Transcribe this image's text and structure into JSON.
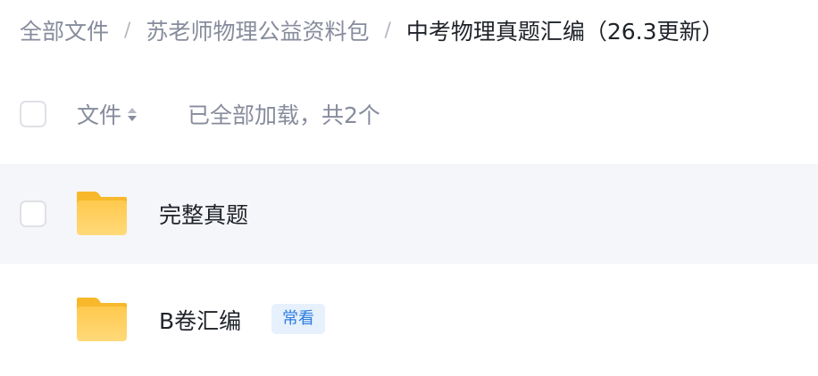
{
  "breadcrumb": {
    "items": [
      "全部文件",
      "苏老师物理公益资料包",
      "中考物理真题汇编（26.3更新）"
    ],
    "separator": "/"
  },
  "list_header": {
    "file_column_label": "文件",
    "sort_icon": "sort-updown-icon",
    "load_status": "已全部加载，共2个"
  },
  "files": [
    {
      "name": "完整真题",
      "type": "folder",
      "icon": "folder-icon",
      "tag": ""
    },
    {
      "name": "B卷汇编",
      "type": "folder",
      "icon": "folder-icon",
      "tag": "常看"
    }
  ],
  "colors": {
    "folder": "#ffc84a",
    "row_hover": "#f5f6f9",
    "tag_background": "#e6f1fd",
    "tag_text": "#2d7de0",
    "muted_text": "#878c9c"
  }
}
